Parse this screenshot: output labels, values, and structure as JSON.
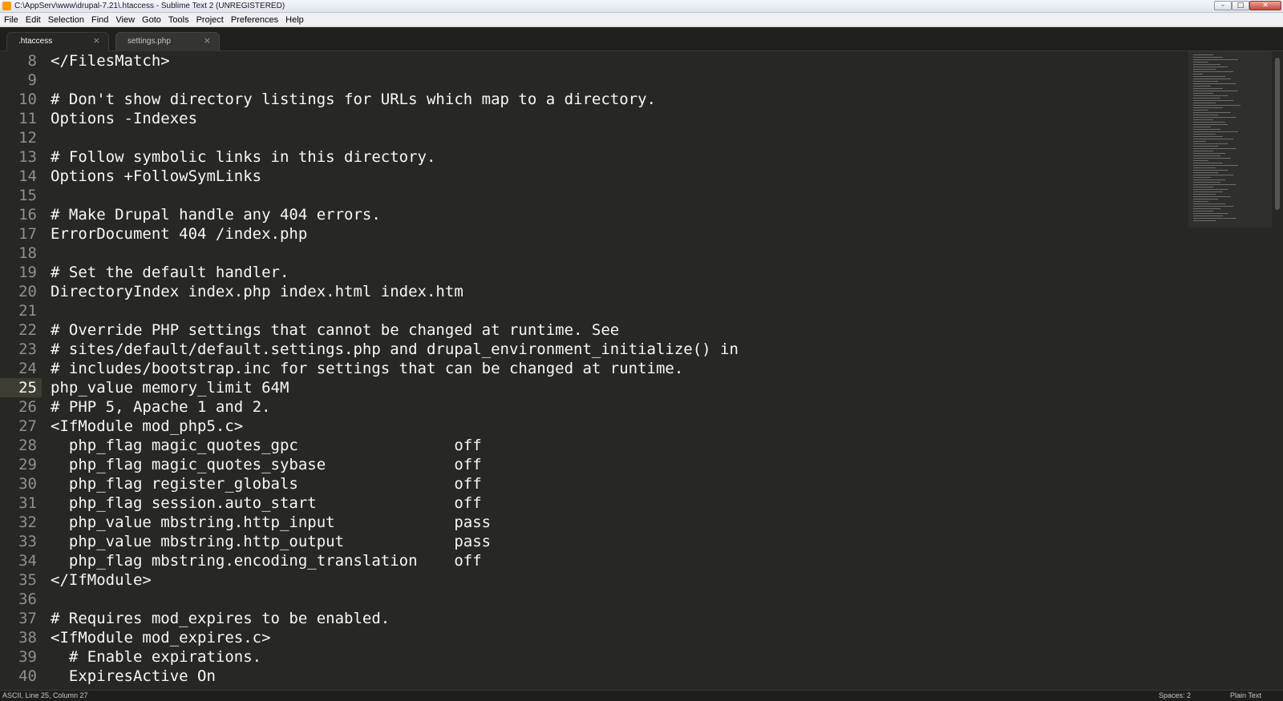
{
  "window": {
    "title": "C:\\AppServ\\www\\drupal-7.21\\.htaccess - Sublime Text 2 (UNREGISTERED)",
    "minimize_glyph": "–",
    "maximize_glyph": "□",
    "close_glyph": "✕"
  },
  "menu": {
    "items": [
      "File",
      "Edit",
      "Selection",
      "Find",
      "View",
      "Goto",
      "Tools",
      "Project",
      "Preferences",
      "Help"
    ]
  },
  "tabs": [
    {
      "label": ".htaccess",
      "active": true,
      "close_glyph": "×"
    },
    {
      "label": "settings.php",
      "active": false,
      "close_glyph": "×"
    }
  ],
  "editor": {
    "current_line": 25,
    "lines": [
      {
        "num": "8",
        "text": "</FilesMatch>"
      },
      {
        "num": "9",
        "text": ""
      },
      {
        "num": "10",
        "text": "# Don't show directory listings for URLs which map to a directory."
      },
      {
        "num": "11",
        "text": "Options -Indexes"
      },
      {
        "num": "12",
        "text": ""
      },
      {
        "num": "13",
        "text": "# Follow symbolic links in this directory."
      },
      {
        "num": "14",
        "text": "Options +FollowSymLinks"
      },
      {
        "num": "15",
        "text": ""
      },
      {
        "num": "16",
        "text": "# Make Drupal handle any 404 errors."
      },
      {
        "num": "17",
        "text": "ErrorDocument 404 /index.php"
      },
      {
        "num": "18",
        "text": ""
      },
      {
        "num": "19",
        "text": "# Set the default handler."
      },
      {
        "num": "20",
        "text": "DirectoryIndex index.php index.html index.htm"
      },
      {
        "num": "21",
        "text": ""
      },
      {
        "num": "22",
        "text": "# Override PHP settings that cannot be changed at runtime. See"
      },
      {
        "num": "23",
        "text": "# sites/default/default.settings.php and drupal_environment_initialize() in"
      },
      {
        "num": "24",
        "text": "# includes/bootstrap.inc for settings that can be changed at runtime."
      },
      {
        "num": "25",
        "text": "php_value memory_limit 64M"
      },
      {
        "num": "26",
        "text": "# PHP 5, Apache 1 and 2."
      },
      {
        "num": "27",
        "text": "<IfModule mod_php5.c>"
      },
      {
        "num": "28",
        "text": "  php_flag magic_quotes_gpc                 off"
      },
      {
        "num": "29",
        "text": "  php_flag magic_quotes_sybase              off"
      },
      {
        "num": "30",
        "text": "  php_flag register_globals                 off"
      },
      {
        "num": "31",
        "text": "  php_flag session.auto_start               off"
      },
      {
        "num": "32",
        "text": "  php_value mbstring.http_input             pass"
      },
      {
        "num": "33",
        "text": "  php_value mbstring.http_output            pass"
      },
      {
        "num": "34",
        "text": "  php_flag mbstring.encoding_translation    off"
      },
      {
        "num": "35",
        "text": "</IfModule>"
      },
      {
        "num": "36",
        "text": ""
      },
      {
        "num": "37",
        "text": "# Requires mod_expires to be enabled."
      },
      {
        "num": "38",
        "text": "<IfModule mod_expires.c>"
      },
      {
        "num": "39",
        "text": "  # Enable expirations."
      },
      {
        "num": "40",
        "text": "  ExpiresActive On"
      }
    ]
  },
  "status": {
    "left": "ASCII, Line 25, Column 27",
    "spaces": "Spaces: 2",
    "syntax": "Plain Text"
  },
  "colors": {
    "editor_bg": "#272822",
    "text": "#f8f8f2",
    "line_number": "#8f908a",
    "current_line_gutter": "#3e3d32"
  }
}
